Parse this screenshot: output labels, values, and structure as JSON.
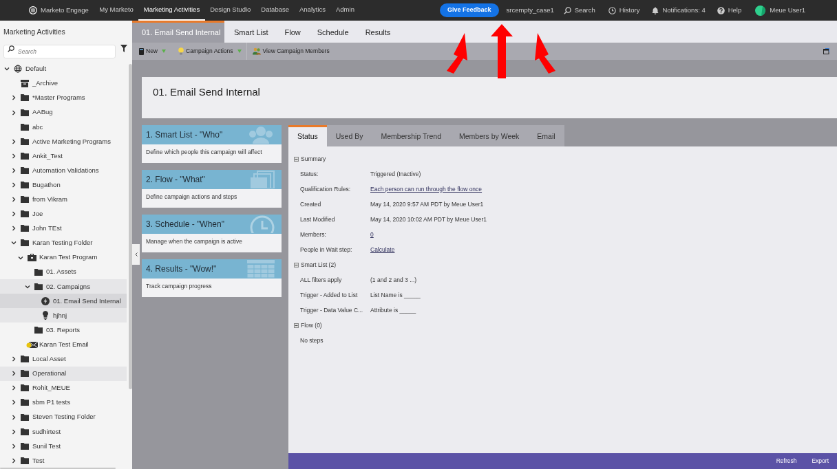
{
  "top_nav": {
    "brand": "Marketo Engage",
    "items": [
      {
        "label": "My Marketo",
        "selected": false
      },
      {
        "label": "Marketing Activities",
        "selected": true
      },
      {
        "label": "Design Studio",
        "selected": false
      },
      {
        "label": "Database",
        "selected": false
      },
      {
        "label": "Analytics",
        "selected": false
      },
      {
        "label": "Admin",
        "selected": false
      }
    ],
    "feedback_button": "Give Feedback",
    "workspace": "srcempty_case1",
    "search": "Search",
    "history": "History",
    "notifications": "Notifications: 4",
    "help": "Help",
    "user": "Meue User1"
  },
  "sidebar": {
    "title": "Marketing Activities",
    "search": {
      "placeholder": "Search"
    },
    "tree": [
      {
        "label": "Default",
        "kind": "globe",
        "expanded": true,
        "selected": false,
        "highlighted": false,
        "children": [
          {
            "label": "_Archive",
            "kind": "archive",
            "selected": false,
            "highlighted": false
          },
          {
            "label": "*Master Programs",
            "kind": "folder",
            "expanded": false,
            "selected": false,
            "highlighted": false
          },
          {
            "label": "AABug",
            "kind": "folder",
            "expanded": false,
            "selected": false,
            "highlighted": false
          },
          {
            "label": "abc",
            "kind": "folder",
            "selected": false,
            "highlighted": false
          },
          {
            "label": "Active Marketing Programs",
            "kind": "folder",
            "expanded": false,
            "selected": false,
            "highlighted": false
          },
          {
            "label": "Ankit_Test",
            "kind": "folder",
            "expanded": false,
            "selected": false,
            "highlighted": false
          },
          {
            "label": "Automation Validations",
            "kind": "folder",
            "expanded": false,
            "selected": false,
            "highlighted": false
          },
          {
            "label": "Bugathon",
            "kind": "folder",
            "expanded": false,
            "selected": false,
            "highlighted": false
          },
          {
            "label": "from Vikram",
            "kind": "folder",
            "expanded": false,
            "selected": false,
            "highlighted": false
          },
          {
            "label": "Joe",
            "kind": "folder",
            "expanded": false,
            "selected": false,
            "highlighted": false
          },
          {
            "label": "John TEst",
            "kind": "folder",
            "expanded": false,
            "selected": false,
            "highlighted": false
          },
          {
            "label": "Karan Testing Folder",
            "kind": "folder",
            "expanded": true,
            "selected": false,
            "highlighted": false,
            "children": [
              {
                "label": "Karan Test Program",
                "kind": "program",
                "expanded": true,
                "selected": false,
                "highlighted": false,
                "children": [
                  {
                    "label": "01. Assets",
                    "kind": "folder",
                    "selected": false,
                    "highlighted": false
                  },
                  {
                    "label": "02. Campaigns",
                    "kind": "folder",
                    "expanded": true,
                    "selected": false,
                    "highlighted": true,
                    "children": [
                      {
                        "label": "01. Email Send Internal",
                        "kind": "trigger",
                        "selected": true,
                        "highlighted": false
                      },
                      {
                        "label": "hjhnj",
                        "kind": "batch",
                        "selected": false,
                        "highlighted": true
                      }
                    ]
                  },
                  {
                    "label": "03. Reports",
                    "kind": "folder",
                    "selected": false,
                    "highlighted": false
                  }
                ]
              },
              {
                "label": "Karan Test Email",
                "kind": "email",
                "selected": false,
                "highlighted": false
              }
            ]
          },
          {
            "label": "Local Asset",
            "kind": "folder",
            "expanded": false,
            "selected": false,
            "highlighted": false
          },
          {
            "label": "Operational",
            "kind": "folder",
            "expanded": false,
            "selected": false,
            "highlighted": true
          },
          {
            "label": "Rohit_MEUE",
            "kind": "folder",
            "expanded": false,
            "selected": false,
            "highlighted": false
          },
          {
            "label": "sbm P1 tests",
            "kind": "folder",
            "expanded": false,
            "selected": false,
            "highlighted": false
          },
          {
            "label": "Steven Testing Folder",
            "kind": "folder",
            "expanded": false,
            "selected": false,
            "highlighted": false
          },
          {
            "label": "sudhirtest",
            "kind": "folder",
            "expanded": false,
            "selected": false,
            "highlighted": false
          },
          {
            "label": "Sunil Test",
            "kind": "folder",
            "expanded": false,
            "selected": false,
            "highlighted": false
          },
          {
            "label": "Test",
            "kind": "folder",
            "expanded": false,
            "selected": false,
            "highlighted": false
          }
        ]
      }
    ]
  },
  "tabs": [
    {
      "label": "01. Email Send Internal",
      "selected": true
    },
    {
      "label": "Smart List",
      "selected": false
    },
    {
      "label": "Flow",
      "selected": false
    },
    {
      "label": "Schedule",
      "selected": false
    },
    {
      "label": "Results",
      "selected": false
    }
  ],
  "toolbar": [
    {
      "label": "New",
      "kind": "new"
    },
    {
      "label": "Campaign Actions",
      "kind": "actions"
    },
    {
      "label": "View Campaign Members",
      "kind": "members"
    }
  ],
  "campaign_title": "01. Email Send Internal",
  "cards": [
    {
      "title": "1. Smart List - \"Who\"",
      "description": "Define which people this campaign will affect",
      "kind": "people"
    },
    {
      "title": "2. Flow - \"What\"",
      "description": "Define campaign actions and steps",
      "kind": "pages"
    },
    {
      "title": "3. Schedule - \"When\"",
      "description": "Manage when the campaign is active",
      "kind": "clock"
    },
    {
      "title": "4. Results - \"Wow!\"",
      "description": "Track campaign progress",
      "kind": "grid"
    }
  ],
  "detail_tabs": [
    {
      "label": "Status",
      "selected": true
    },
    {
      "label": "Used By",
      "selected": false
    },
    {
      "label": "Membership Trend",
      "selected": false
    },
    {
      "label": "Members by Week",
      "selected": false
    },
    {
      "label": "Email",
      "selected": false
    }
  ],
  "sections": [
    {
      "title": "Summary",
      "expanded": true,
      "rows": [
        {
          "label": "Status:",
          "value": "Triggered (Inactive)",
          "kind": "text"
        },
        {
          "label": "Qualification Rules:",
          "value": "Each person can run through the flow once",
          "kind": "link"
        },
        {
          "label": "Created",
          "value": "May 14, 2020 9:57 AM PDT by Meue User1",
          "kind": "text"
        },
        {
          "label": "Last Modified",
          "value": "May 14, 2020 10:02 AM PDT by Meue User1",
          "kind": "text"
        },
        {
          "label": "Members:",
          "value": "0",
          "kind": "link"
        },
        {
          "label": "People in Wait step:",
          "value": "Calculate",
          "kind": "link"
        }
      ]
    },
    {
      "title": "Smart List (2)",
      "expanded": true,
      "rows": [
        {
          "label": "ALL filters apply",
          "value": "(1 and 2 and 3 ...)",
          "kind": "text"
        },
        {
          "label": "Trigger - Added to List",
          "value": "List Name is _____",
          "kind": "text"
        },
        {
          "label": "Trigger - Data Value C...",
          "value": "Attribute is _____",
          "kind": "text"
        }
      ]
    },
    {
      "title": "Flow (0)",
      "expanded": true,
      "rows": [
        {
          "label": "No steps",
          "kind": "note"
        }
      ]
    }
  ],
  "footer_buttons": [
    "Refresh",
    "Export"
  ]
}
